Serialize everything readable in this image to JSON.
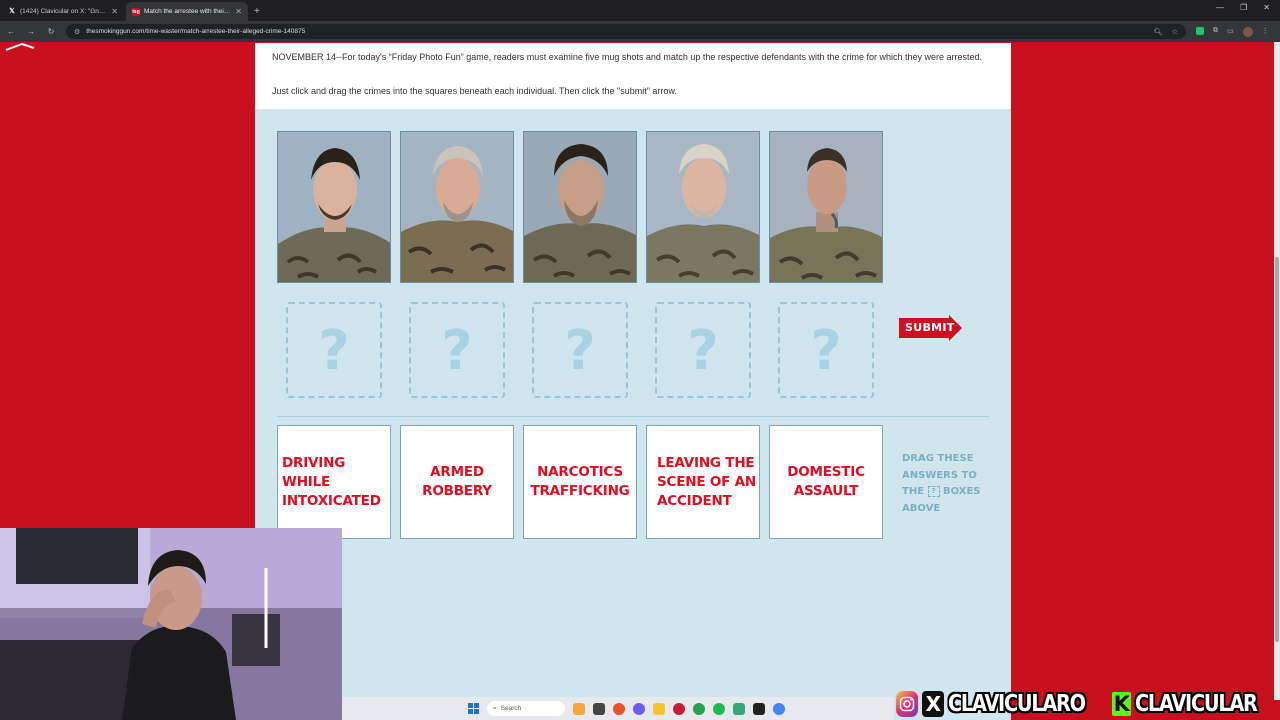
{
  "browser": {
    "tabs": [
      {
        "favicon": "x-icon",
        "title": "(1424) Clavicular on X: \"Gna liv",
        "active": false
      },
      {
        "favicon": "tsg-icon",
        "title": "Match the arrestee with their alleged crime",
        "active": true
      }
    ],
    "new_tab": "+",
    "url": "thesmokinggun.com/time-waster/match-arrestee-their-alleged-crime-140875"
  },
  "article": {
    "intro": "NOVEMBER 14--For today's “Friday Photo Fun” game, readers must examine five mug shots and match up the respective defendants with the crime for which they were arrested.",
    "instructions": "Just click and drag the crimes into the squares beneath each individual. Then click the \"submit\" arrow."
  },
  "game": {
    "mugshots": [
      {
        "alt": "Mugshot 1"
      },
      {
        "alt": "Mugshot 2"
      },
      {
        "alt": "Mugshot 3"
      },
      {
        "alt": "Mugshot 4"
      },
      {
        "alt": "Mugshot 5"
      }
    ],
    "drop_slots": [
      "?",
      "?",
      "?",
      "?",
      "?"
    ],
    "submit_label": "SUBMIT",
    "answers": [
      "DRIVING WHILE INTOXICATED",
      "ARMED ROBBERY",
      "NARCOTICS TRAFFICKING",
      "LEAVING THE SCENE OF AN ACCIDENT",
      "DOMESTIC ASSAULT"
    ],
    "hint_pre": "DRAG THESE ANSWERS TO THE",
    "hint_box": "?",
    "hint_post": "BOXES ABOVE"
  },
  "taskbar": {
    "search_placeholder": "Search"
  },
  "overlay": {
    "handle_1": "CLAVICULARO",
    "handle_2": "CLAVICULAR",
    "kick_letter": "K",
    "x_letter": "X"
  },
  "colors": {
    "page_red": "#c8101e",
    "panel_blue": "#cfe6ee",
    "answer_red": "#e30c1e",
    "hint_blue": "#7dafc4",
    "kick_green": "#53fc18"
  }
}
